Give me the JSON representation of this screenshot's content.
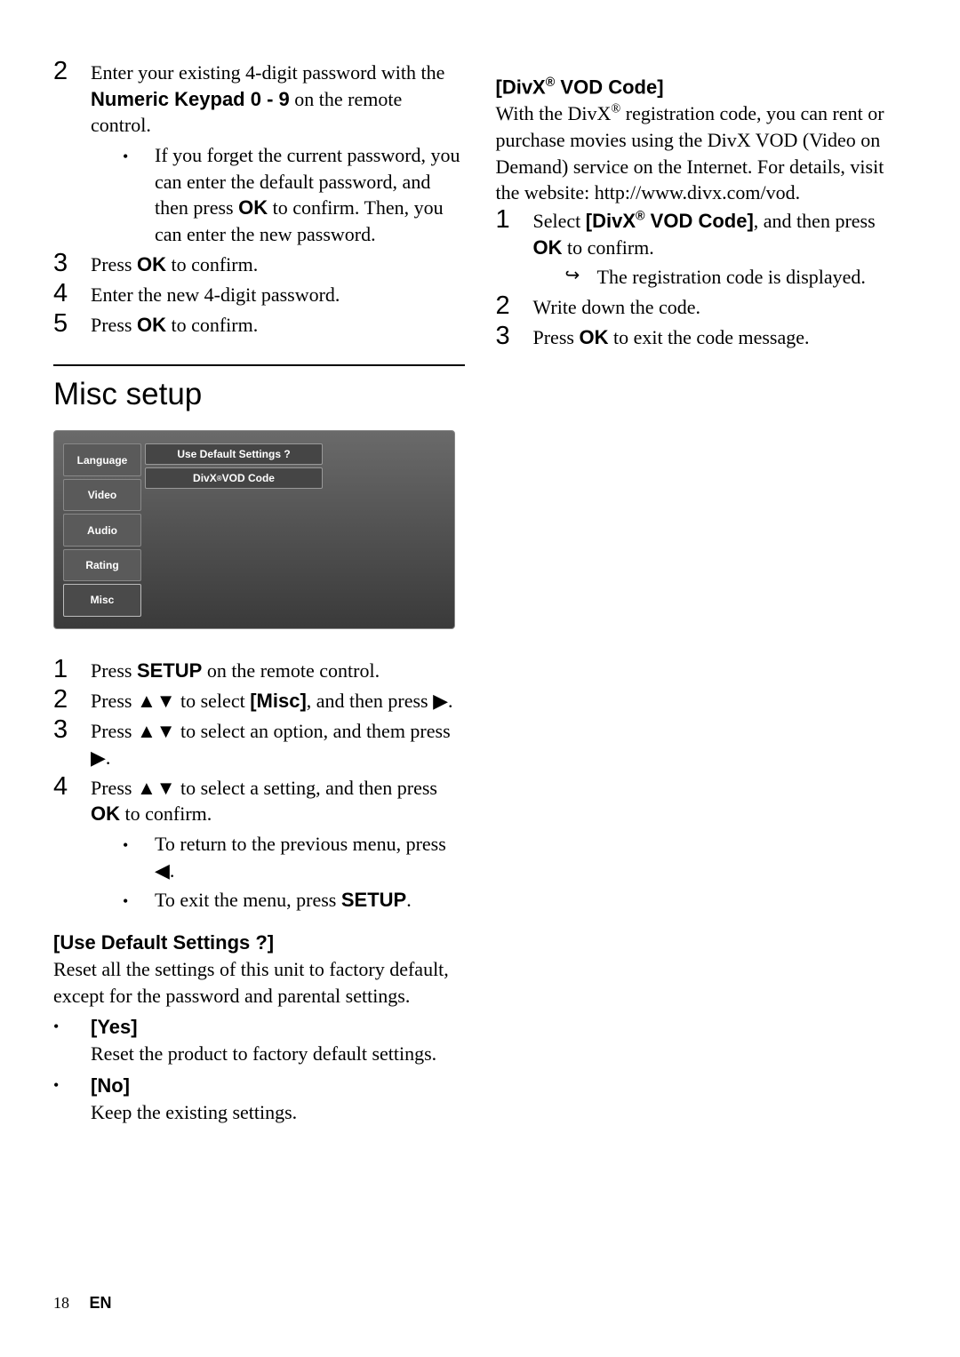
{
  "left": {
    "steps_top": [
      {
        "n": "2",
        "text": "Enter your existing 4-digit password with the |b|Numeric Keypad 0 - 9|/b| on the remote control.",
        "subs": [
          {
            "type": "dot",
            "text": "If you forget the current password, you can enter the default password, and then press |b|OK|/b| to confirm. Then, you can enter the new password."
          }
        ]
      },
      {
        "n": "3",
        "text": "Press |b|OK|/b| to confirm."
      },
      {
        "n": "4",
        "text": "Enter the new 4-digit password."
      },
      {
        "n": "5",
        "text": "Press |b|OK|/b| to confirm."
      }
    ],
    "heading": "Misc setup",
    "menu": {
      "tabs": [
        "Language",
        "Video",
        "Audio",
        "Rating",
        "Misc"
      ],
      "active": 4,
      "options": [
        "Use Default Settings ?",
        "DivX® VOD Code"
      ]
    },
    "steps_mid": [
      {
        "n": "1",
        "text": "Press |b|SETUP|/b| on the remote control."
      },
      {
        "n": "2",
        "text": "Press ▲▼ to select |b|[Misc]|/b|, and then press ▶."
      },
      {
        "n": "3",
        "text": "Press ▲▼ to select an option, and them press ▶."
      },
      {
        "n": "4",
        "text": "Press ▲▼ to select a setting, and then press |b|OK|/b| to confirm.",
        "subs": [
          {
            "type": "dot",
            "text": "To return to the previous menu, press ◀."
          },
          {
            "type": "dot",
            "text": "To exit the menu, press |b|SETUP|/b|."
          }
        ]
      }
    ],
    "uds": {
      "head": "[Use Default Settings ?]",
      "desc": "Reset all the settings of this unit to factory default, except for the password and parental settings.",
      "opts": [
        {
          "label": "[Yes]",
          "text": "Reset the product to factory default settings."
        },
        {
          "label": "[No]",
          "text": "Keep the existing settings."
        }
      ]
    }
  },
  "right": {
    "vod": {
      "head": "[DivX® VOD Code]",
      "desc": "With the DivX® registration code, you can rent or purchase movies using the DivX VOD (Video on Demand) service on the Internet. For details, visit the website: http://www.divx.com/vod.",
      "steps": [
        {
          "n": "1",
          "text": "Select |b|[DivX® VOD Code]|/b|, and then press |b|OK|/b| to confirm.",
          "subs": [
            {
              "type": "arr",
              "text": "The registration code is displayed."
            }
          ]
        },
        {
          "n": "2",
          "text": "Write down the code."
        },
        {
          "n": "3",
          "text": "Press |b|OK|/b| to exit the code message."
        }
      ]
    }
  },
  "footer": {
    "page": "18",
    "lang": "EN"
  }
}
